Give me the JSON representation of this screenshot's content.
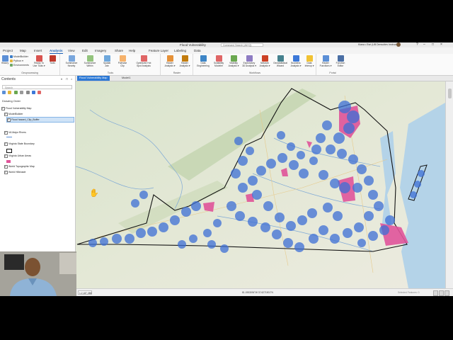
{
  "window": {
    "title": "Flood Vulnerability",
    "search_placeholder": "Command Search (Alt+Q)",
    "user": "Kiana • Esri (UB Demo/dev Instructor)",
    "controls": [
      "?",
      "–",
      "□",
      "×"
    ]
  },
  "ribbon_tabs": [
    "Project",
    "Map",
    "Insert",
    "Analysis",
    "View",
    "Edit",
    "Imagery",
    "Share",
    "Help",
    "Feature Layer",
    "Labeling",
    "Data"
  ],
  "active_tab": "Analysis",
  "ribbon": {
    "geoprocessing": {
      "label": "Geoprocessing",
      "history": "History",
      "small": [
        "ModelBuilder",
        "Python ▾",
        "Environments"
      ],
      "ready": "Ready To\nUse Tools ▾",
      "tools": "Tools"
    },
    "tools_group": {
      "label": "Tools",
      "buttons": [
        "Summarize\nNearby",
        "Summarize\nWithin",
        "Spatial\nJoin",
        "Pairwise\nClip",
        "Optimized Hot\nSpot Analysis"
      ]
    },
    "raster": {
      "label": "Raster",
      "buttons": [
        "Raster\nAnalysis ▾",
        "Raster\nAnalysis ▾"
      ]
    },
    "workflows": {
      "label": "Workflows",
      "buttons": [
        "Data\nEngineering",
        "Suitability\nModeler",
        "Visibility\nAnalysis ▾",
        "Exploratory\n3D Analysis ▾",
        "Network\nAnalysis ▾",
        "Geostatistical\nWizard",
        "Business\nAnalysis ▾",
        "Data\nInterop ▾"
      ]
    },
    "portal": {
      "label": "Portal",
      "buttons": [
        "Raster\nFunctions ▾",
        "Function\nEditor"
      ]
    }
  },
  "contents": {
    "title": "Contents",
    "search_placeholder": "Search",
    "drawing_order": "Drawing Order",
    "layers": [
      {
        "name": "Flood Vulnerability Map",
        "checked": true,
        "indent": 0
      },
      {
        "name": "ModelBuilder",
        "checked": true,
        "indent": 1
      },
      {
        "name": "Flood hazard_Clip_Buffer",
        "checked": true,
        "indent": 2,
        "selected": true
      },
      {
        "name": "VA Major Rivers",
        "checked": true,
        "indent": 1
      },
      {
        "name": "Virginia State Boundary",
        "checked": true,
        "indent": 1
      },
      {
        "name": "Virginia Urban Areas",
        "checked": true,
        "indent": 1
      },
      {
        "name": "World Topographic Map",
        "checked": true,
        "indent": 1
      },
      {
        "name": "World Hillshade",
        "checked": true,
        "indent": 1
      }
    ]
  },
  "map_tabs": [
    "Flood Vulnerability Map",
    "Model1"
  ],
  "status": {
    "scale": "1:2,187,386",
    "coordinates": "81.1953094°W 37.6271901°N",
    "selected_features": "Selected Features: 0"
  },
  "colors": {
    "accent": "#2b78d5",
    "buffer": "#3d6fd6",
    "urban": "#e0549a",
    "boundary": "#111111"
  }
}
